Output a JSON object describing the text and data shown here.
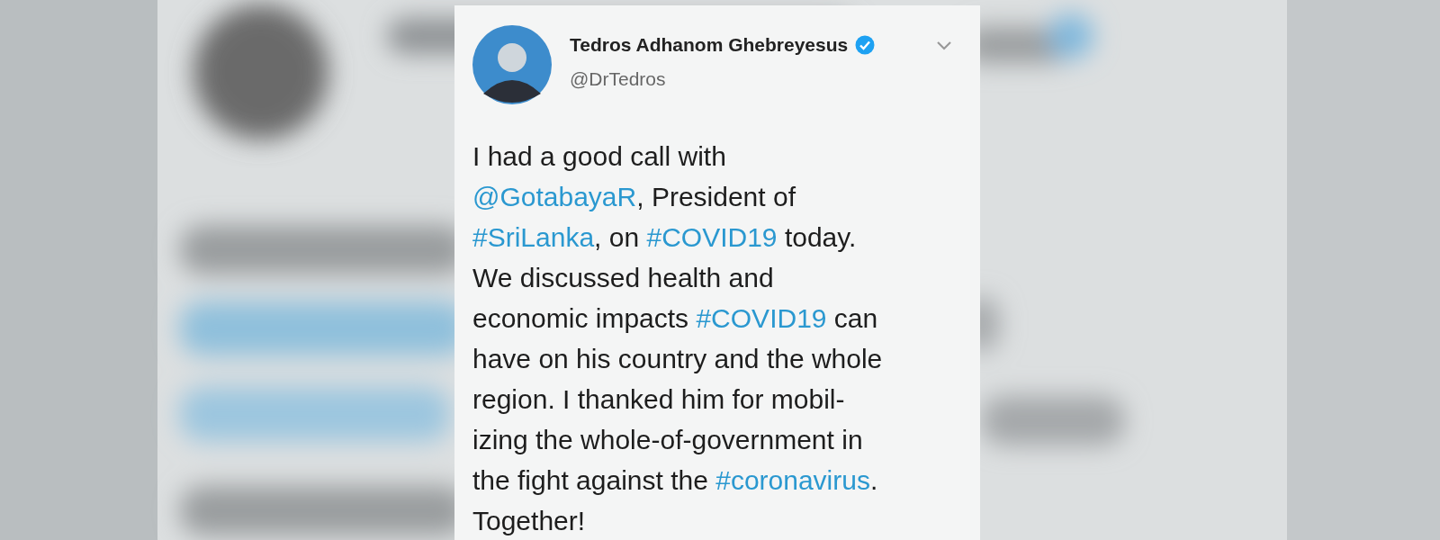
{
  "tweet": {
    "author": {
      "name": "Tedros Adhanom Ghebreyesus",
      "verified": true,
      "handle": "@DrTedros"
    },
    "body": [
      {
        "kind": "text",
        "text": "I had a good call with\n"
      },
      {
        "kind": "mention",
        "text": "@GotabayaR"
      },
      {
        "kind": "text",
        "text": ", President of\n"
      },
      {
        "kind": "hashtag",
        "text": "#SriLanka"
      },
      {
        "kind": "text",
        "text": ", on "
      },
      {
        "kind": "hashtag",
        "text": "#COVID19"
      },
      {
        "kind": "text",
        "text": " today.\nWe discussed health and\neconomic impacts "
      },
      {
        "kind": "hashtag",
        "text": "#COVID19"
      },
      {
        "kind": "text",
        "text": " can\nhave on his country and the whole\nregion. I thanked him for mobil-\nizing the whole-of-government in\nthe fight against the "
      },
      {
        "kind": "hashtag",
        "text": "#coronavirus"
      },
      {
        "kind": "text",
        "text": ".\nTogether!"
      }
    ]
  }
}
